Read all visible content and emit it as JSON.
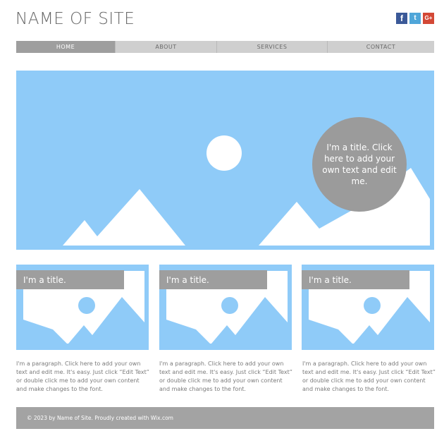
{
  "header": {
    "site_title": "NAME OF SITE",
    "social": [
      {
        "label": "f",
        "icon": "facebook-icon",
        "color": "#3b5998"
      },
      {
        "label": "t",
        "icon": "twitter-icon",
        "color": "#4fa6d9"
      },
      {
        "label": "G+",
        "icon": "google-plus-icon",
        "color": "#d34836"
      }
    ]
  },
  "nav": {
    "items": [
      {
        "label": "HOME",
        "active": true
      },
      {
        "label": "ABOUT",
        "active": false
      },
      {
        "label": "SERVICES",
        "active": false
      },
      {
        "label": "CONTACT",
        "active": false
      }
    ]
  },
  "hero": {
    "title": "I'm a title. Click here to add your own text and edit me.",
    "image_icon": "landscape-image-placeholder"
  },
  "cards": [
    {
      "title": "I'm a title.",
      "paragraph": "I'm a paragraph. Click here to add your own text and edit me. It's easy. Just click “Edit Text” or double click me to add your own content and make changes to the font."
    },
    {
      "title": "I'm a title.",
      "paragraph": "I'm a paragraph. Click here to add your own text and edit me. It's easy. Just click “Edit Text” or double click me to add your own content and make changes to the font."
    },
    {
      "title": "I'm a title.",
      "paragraph": "I'm a paragraph. Click here to add your own text and edit me. It's easy. Just click “Edit Text” or double click me to add your own content and make changes to the font."
    }
  ],
  "footer": {
    "text": "© 2023 by Name of Site. Proudly created with Wix.com"
  },
  "colors": {
    "sky": "#8fcbf8",
    "nav_bg": "#cfcfcf",
    "nav_active": "#9e9e9e",
    "bubble": "#9b9b9b",
    "footer_bg": "#a3a3a3"
  }
}
